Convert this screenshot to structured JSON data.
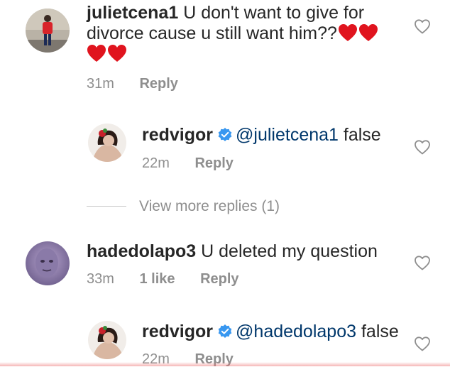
{
  "comments": [
    {
      "username": "julietcena1",
      "text": "U don't want to give for divorce cause u still want him??",
      "hearts_emoji_count": 4,
      "time": "31m",
      "reply_label": "Reply"
    },
    {
      "username": "redvigor",
      "verified": true,
      "mention": "@julietcena1",
      "text": "false",
      "time": "22m",
      "reply_label": "Reply"
    },
    {
      "username": "hadedolapo3",
      "text": "U deleted my question",
      "time": "33m",
      "likes": "1 like",
      "reply_label": "Reply"
    },
    {
      "username": "redvigor",
      "verified": true,
      "mention": "@hadedolapo3",
      "text": "false",
      "time": "22m",
      "reply_label": "Reply"
    }
  ],
  "view_more_replies": "View more replies (1)",
  "colors": {
    "text": "#262626",
    "meta": "#8e8e8e",
    "mention": "#00376b",
    "verified": "#3897f0",
    "heart_emoji": "#e0141e"
  },
  "icons": {
    "like": "heart-outline-icon",
    "verified": "verified-badge-icon",
    "emoji": "red-heart-emoji-icon"
  }
}
